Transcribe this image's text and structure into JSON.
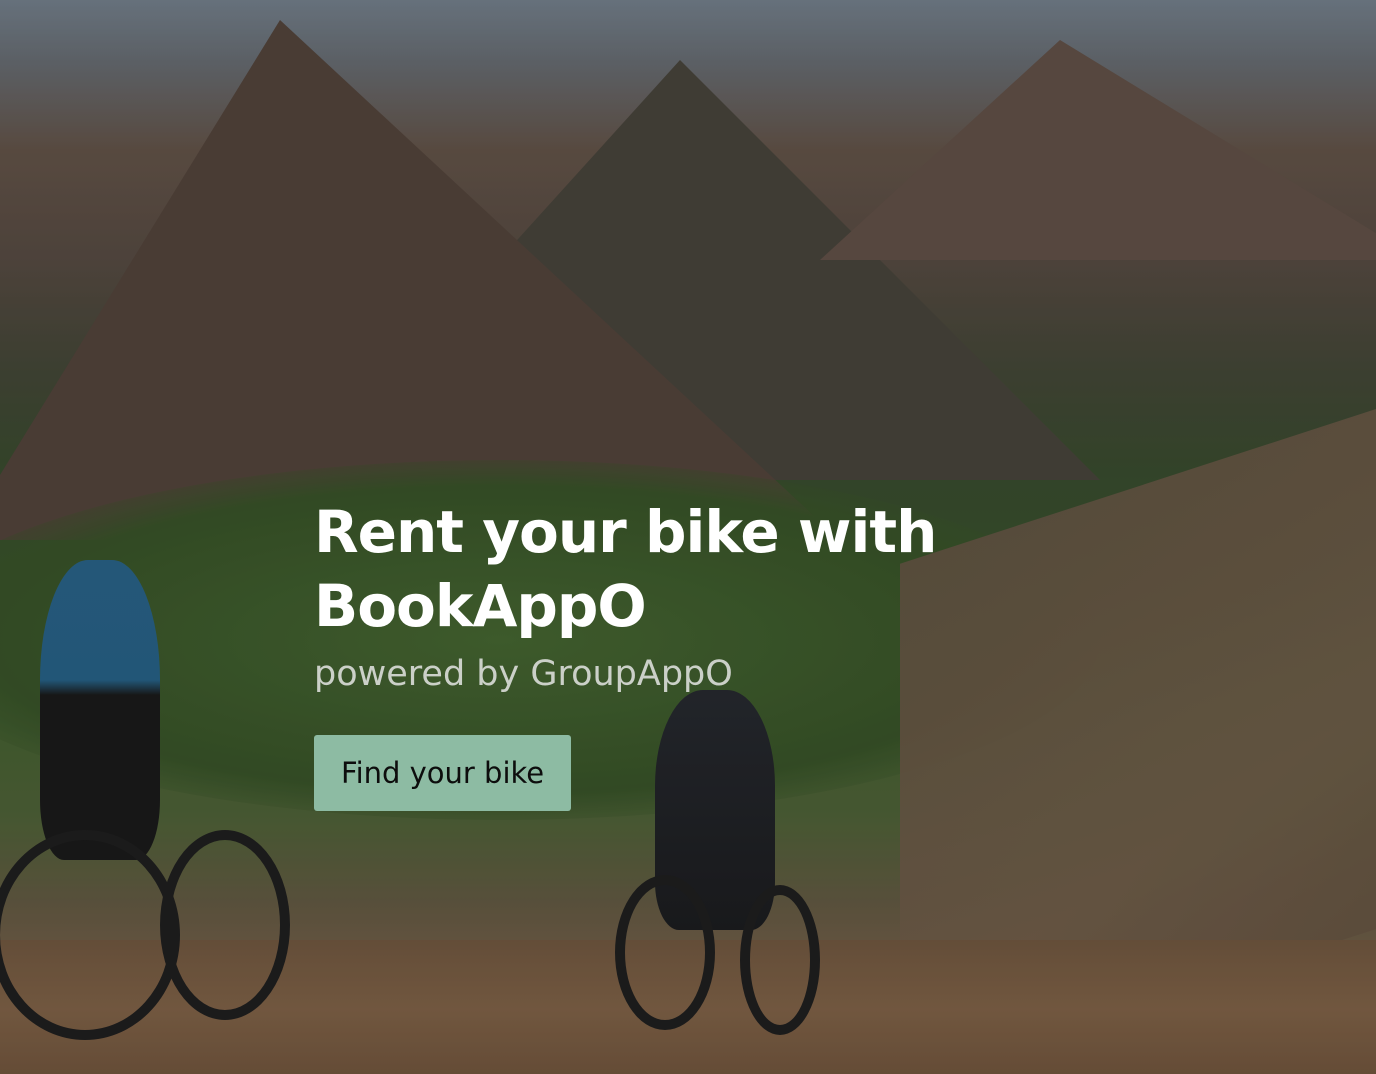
{
  "hero": {
    "title_line1": "Rent your bike with",
    "title_line2": "BookAppO",
    "subtitle": "powered by GroupAppO",
    "cta_label": "Find your bike",
    "cta_color": "#8dbba3"
  }
}
